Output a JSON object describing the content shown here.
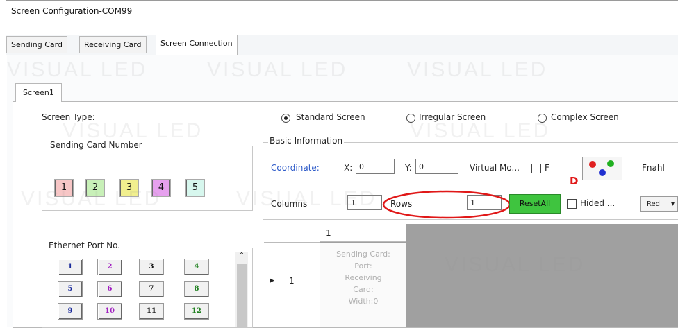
{
  "window": {
    "title": "Screen Configuration-COM99"
  },
  "tabs": [
    {
      "label": "Sending Card"
    },
    {
      "label": "Receiving Card"
    },
    {
      "label": "Screen Connection"
    }
  ],
  "screen_tab": {
    "label": "Screen1"
  },
  "screen_type": {
    "label": "Screen Type:",
    "options": [
      "Standard Screen",
      "Irregular Screen",
      "Complex Screen"
    ],
    "selected": "Standard Screen"
  },
  "sending_card": {
    "label": "Sending Card Number",
    "buttons": [
      {
        "label": "1",
        "color": "#f7c6c6"
      },
      {
        "label": "2",
        "color": "#c8f0b8"
      },
      {
        "label": "3",
        "color": "#f1ef8e"
      },
      {
        "label": "4",
        "color": "#e6a0ee"
      },
      {
        "label": "5",
        "color": "#d7f7ee"
      }
    ]
  },
  "basic_info": {
    "label": "Basic Information",
    "coordinate_label": "Coordinate:",
    "x_label": "X:",
    "x_value": "0",
    "y_label": "Y:",
    "y_value": "0",
    "virtual_label": "Virtual Mo...",
    "f_label": "F",
    "enable_label": "Fnahl",
    "columns_label": "Columns",
    "columns_value": "1",
    "rows_label": "Rows",
    "rows_value": "1",
    "reset_label": "ResetAll",
    "hide_label": "Hided ...",
    "color_select": "Red",
    "annotation": "D"
  },
  "ethernet": {
    "label": "Ethernet Port No.",
    "ports": [
      {
        "label": "1",
        "color": "#1a2a9a"
      },
      {
        "label": "2",
        "color": "#a020c0"
      },
      {
        "label": "3",
        "color": "#111111"
      },
      {
        "label": "4",
        "color": "#208020"
      },
      {
        "label": "5",
        "color": "#1a2a9a"
      },
      {
        "label": "6",
        "color": "#a020c0"
      },
      {
        "label": "7",
        "color": "#111111"
      },
      {
        "label": "8",
        "color": "#208020"
      },
      {
        "label": "9",
        "color": "#1a2a9a"
      },
      {
        "label": "10",
        "color": "#a020c0"
      },
      {
        "label": "11",
        "color": "#111111"
      },
      {
        "label": "12",
        "color": "#208020"
      }
    ]
  },
  "grid": {
    "column_header": "1",
    "row_header": "1",
    "cell_lines": [
      "Sending Card:",
      "Port:",
      "Receiving",
      "Card:",
      "Width:0"
    ]
  },
  "watermark": {
    "text": "VISUAL LED"
  }
}
